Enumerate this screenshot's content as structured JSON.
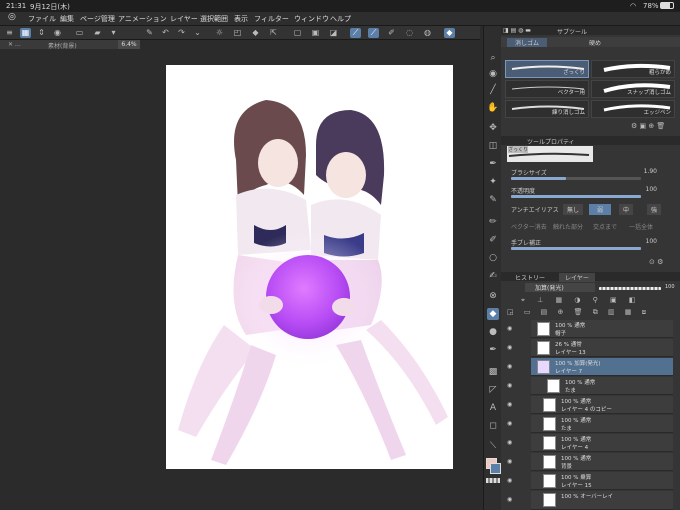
{
  "status": {
    "time": "21:31",
    "date": "9月12日(木)",
    "battery": "78%"
  },
  "menu": [
    "ファイル",
    "編集",
    "ページ管理",
    "アニメーション",
    "レイヤー",
    "選択範囲",
    "表示",
    "フィルター",
    "ウィンドウ",
    "ヘルプ"
  ],
  "canvas_tab": {
    "title": "素材(背景)",
    "zoom": "6.4%"
  },
  "subtool_panel": {
    "tab1": "消しゴム",
    "tab2": "サブツール",
    "tab3": "硬め",
    "brushes": [
      "ざっくり",
      "粗らかめ",
      "ベクター用",
      "スナップ消しゴム",
      "練り消しゴム",
      "エッジペン"
    ]
  },
  "tool_property": {
    "title": "ツールプロパティ",
    "subtitle": "ざっくり",
    "brush_size_label": "ブラシサイズ",
    "brush_size_value": "1.90",
    "opacity_label": "不透明度",
    "opacity_value": "100",
    "antialias_label": "アンチエイリアス",
    "antialias_options": [
      "無し",
      "弱",
      "中",
      "強"
    ],
    "vector_erase": "ベクター消去",
    "touched_part": "触れた部分",
    "to_intersection": "交点まで",
    "erase_all": "一括全体",
    "stabilization_label": "手ブレ補正",
    "stabilization_value": "100"
  },
  "layer_panel": {
    "tab_history": "ヒストリー",
    "tab_layer": "レイヤー",
    "blend_mode": "加算(発光)",
    "opacity": "100",
    "layers": [
      {
        "mode": "100 % 通常",
        "name": "帽子"
      },
      {
        "mode": "26 % 通常",
        "name": "レイヤー 13"
      },
      {
        "mode": "100 % 加算(発光)",
        "name": "レイヤー 7"
      },
      {
        "mode": "100 % 通常",
        "name": "たま"
      },
      {
        "mode": "100 % 通常",
        "name": "レイヤー 4 のコピー"
      },
      {
        "mode": "100 % 通常",
        "name": "たま"
      },
      {
        "mode": "100 % 通常",
        "name": "レイヤー 4"
      },
      {
        "mode": "100 % 通常",
        "name": "背景"
      },
      {
        "mode": "100 % 乗算",
        "name": "レイヤー 15"
      },
      {
        "mode": "100 % オーバーレイ",
        "name": ""
      }
    ]
  },
  "colors": {
    "accent": "#5c7fa8",
    "selected_layer": "#52708f",
    "orb": "#c24dff"
  }
}
